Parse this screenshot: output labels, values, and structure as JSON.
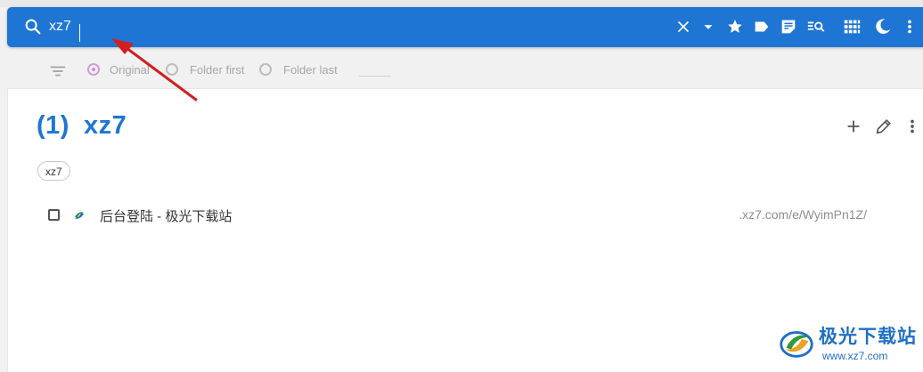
{
  "search": {
    "value": "xz7",
    "placeholder": ""
  },
  "toolbar": {
    "icons": [
      "clear-icon",
      "dropdown-icon",
      "star-icon",
      "label-icon",
      "note-icon",
      "search-list-icon",
      "grid-icon",
      "dark-mode-icon",
      "more-icon"
    ]
  },
  "sort": {
    "options": [
      {
        "label": "Original",
        "selected": true
      },
      {
        "label": "Folder first",
        "selected": false
      },
      {
        "label": "Folder last",
        "selected": false
      }
    ]
  },
  "group": {
    "count": "(1)",
    "title": "xz7",
    "tag": "xz7",
    "actions": [
      "add-icon",
      "edit-icon",
      "more-icon"
    ]
  },
  "items": [
    {
      "title": "后台登陆 - 极光下载站",
      "url": ".xz7.com/e/WyimPn1Z/",
      "checked": false
    }
  ],
  "watermark": {
    "brand": "极光下载站",
    "site": "www.xz7.com"
  },
  "colors": {
    "accent": "#1e75d3",
    "radio_selected": "#c990cc",
    "arrow": "#d11f1f"
  }
}
